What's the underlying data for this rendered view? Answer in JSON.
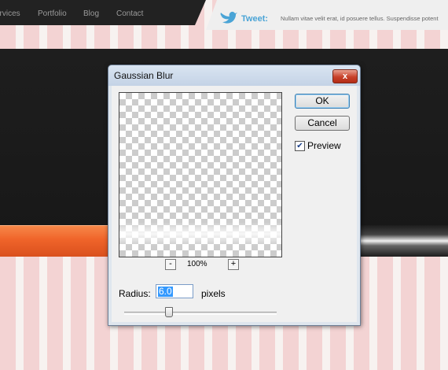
{
  "nav": {
    "items": [
      "ervices",
      "Portfolio",
      "Blog",
      "Contact"
    ]
  },
  "tweet": {
    "label": "Tweet:",
    "text": "Nullam vitae velit erat, id posuere tellus. Suspendisse potent",
    "icon": "twitter-bird-icon"
  },
  "colors": {
    "accent_orange": "#f0642a",
    "tweet_blue": "#4aa4d6"
  },
  "dialog": {
    "title": "Gaussian Blur",
    "close_label": "x",
    "ok_label": "OK",
    "cancel_label": "Cancel",
    "preview_label": "Preview",
    "preview_checked": true,
    "zoom_out_label": "-",
    "zoom_in_label": "+",
    "zoom_level": "100%",
    "radius_label": "Radius:",
    "radius_value": "6.0",
    "radius_units": "pixels"
  }
}
